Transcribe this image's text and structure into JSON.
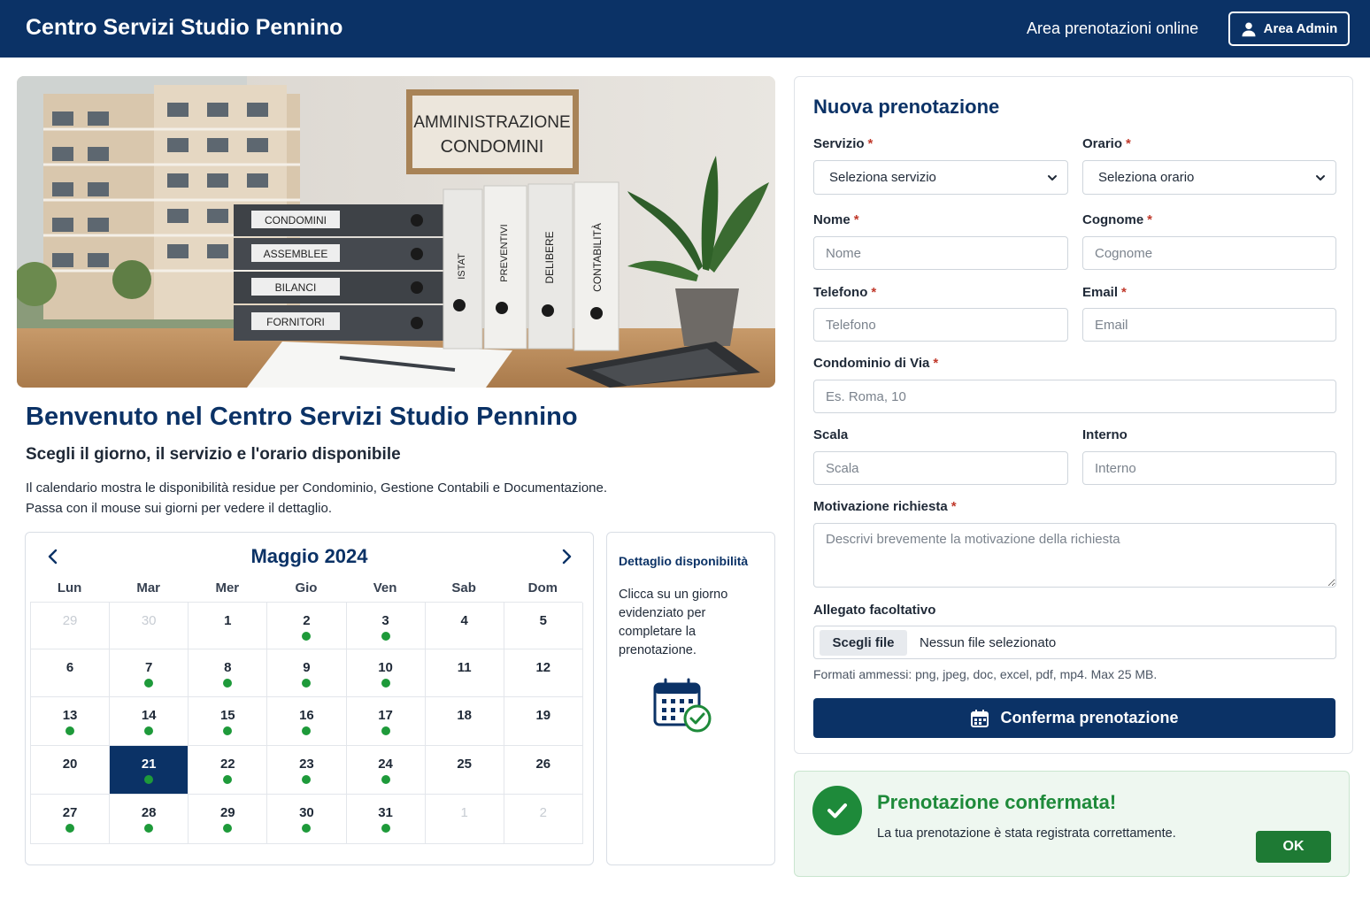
{
  "header": {
    "brand": "Centro Servizi Studio Pennino",
    "nav_label": "Area prenotazioni online",
    "admin_label": "Area Admin"
  },
  "hero": {
    "sign_line1": "AMMINISTRAZIONE",
    "sign_line2": "CONDOMINI",
    "binders_horizontal": [
      "CONDOMINI",
      "ASSEMBLEE",
      "BILANCI",
      "FORNITORI"
    ],
    "binders_vertical": [
      "ISTAT",
      "PREVENTIVI",
      "DELIBERE",
      "CONTABILITÀ"
    ]
  },
  "welcome": {
    "title": "Benvenuto nel Centro Servizi Studio Pennino",
    "subtitle": "Scegli il giorno, il servizio e l'orario disponibile",
    "line1": "Il calendario mostra le disponibilità residue per Condominio, Gestione Contabili e Documentazione.",
    "line2": "Passa con il mouse sui giorni per vedere il dettaglio."
  },
  "calendar": {
    "month_label": "Maggio 2024",
    "prev_icon": "chevron-left-icon",
    "next_icon": "chevron-right-icon",
    "weekdays": [
      "Lun",
      "Mar",
      "Mer",
      "Gio",
      "Ven",
      "Sab",
      "Dom"
    ],
    "dot_color": "#1e9a3a",
    "selected_color": "#0b3266",
    "days": [
      {
        "n": "29",
        "other": true,
        "dot": false
      },
      {
        "n": "30",
        "other": true,
        "dot": false
      },
      {
        "n": "1",
        "dot": false
      },
      {
        "n": "2",
        "dot": true
      },
      {
        "n": "3",
        "dot": true
      },
      {
        "n": "4",
        "dot": false
      },
      {
        "n": "5",
        "dot": false
      },
      {
        "n": "6",
        "dot": false
      },
      {
        "n": "7",
        "dot": true
      },
      {
        "n": "8",
        "dot": true
      },
      {
        "n": "9",
        "dot": true
      },
      {
        "n": "10",
        "dot": true
      },
      {
        "n": "11",
        "dot": false
      },
      {
        "n": "12",
        "dot": false
      },
      {
        "n": "13",
        "dot": true
      },
      {
        "n": "14",
        "dot": true
      },
      {
        "n": "15",
        "dot": true
      },
      {
        "n": "16",
        "dot": true
      },
      {
        "n": "17",
        "dot": true
      },
      {
        "n": "18",
        "dot": false
      },
      {
        "n": "19",
        "dot": false
      },
      {
        "n": "20",
        "dot": false
      },
      {
        "n": "21",
        "dot": true,
        "selected": true
      },
      {
        "n": "22",
        "dot": true
      },
      {
        "n": "23",
        "dot": true
      },
      {
        "n": "24",
        "dot": true
      },
      {
        "n": "25",
        "dot": false
      },
      {
        "n": "26",
        "dot": false
      },
      {
        "n": "27",
        "dot": true
      },
      {
        "n": "28",
        "dot": true
      },
      {
        "n": "29",
        "dot": true
      },
      {
        "n": "30",
        "dot": true
      },
      {
        "n": "31",
        "dot": true
      },
      {
        "n": "1",
        "other": true,
        "dot": false
      },
      {
        "n": "2",
        "other": true,
        "dot": false
      }
    ]
  },
  "detail": {
    "title": "Dettaglio disponibilità",
    "text": "Clicca su un giorno evidenziato per completare la prenotazione.",
    "icon": "calendar-check-icon"
  },
  "form": {
    "title": "Nuova prenotazione",
    "servizio": {
      "label": "Servizio",
      "value": "Seleziona servizio"
    },
    "orario": {
      "label": "Orario",
      "value": "Seleziona orario"
    },
    "nome": {
      "label": "Nome",
      "placeholder": "Nome"
    },
    "cognome": {
      "label": "Cognome",
      "placeholder": "Cognome"
    },
    "telefono": {
      "label": "Telefono",
      "placeholder": "Telefono"
    },
    "email": {
      "label": "Email",
      "placeholder": "Email"
    },
    "condominio": {
      "label": "Condominio di Via",
      "placeholder": "Es. Roma, 10"
    },
    "scala": {
      "label": "Scala",
      "placeholder": "Scala"
    },
    "interno": {
      "label": "Interno",
      "placeholder": "Interno"
    },
    "motivazione": {
      "label": "Motivazione richiesta",
      "placeholder": "Descrivi brevemente la motivazione della richiesta"
    },
    "allegato": {
      "label": "Allegato facoltativo",
      "button": "Scegli file",
      "status": "Nessun file selezionato"
    },
    "hint": "Formati ammessi: png, jpeg, doc, excel, pdf, mp4. Max 25 MB.",
    "required_mark": "*",
    "submit_label": "Conferma prenotazione"
  },
  "success": {
    "title": "Prenotazione confermata!",
    "text": "La tua prenotazione è stata registrata correttamente.",
    "ok_label": "OK"
  },
  "colors": {
    "primary": "#0b3266",
    "success": "#1e8a3a",
    "required": "#c0392b"
  }
}
